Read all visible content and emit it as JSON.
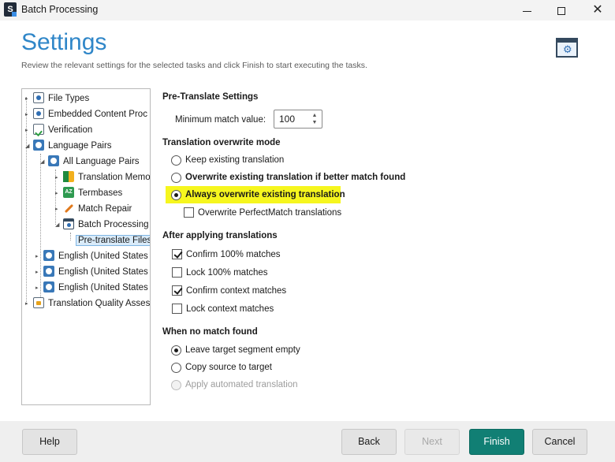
{
  "window": {
    "title": "Batch Processing",
    "app_icon_letter": "S",
    "minimize_icon": "minimize-icon",
    "maximize_icon": "maximize-icon",
    "close_icon": "close-icon",
    "close_glyph": "✕"
  },
  "header": {
    "title": "Settings",
    "subtitle": "Review the relevant settings for the selected tasks and click Finish to start executing the tasks."
  },
  "tree": {
    "items": [
      {
        "label": "File Types",
        "icon": "file-types-icon"
      },
      {
        "label": "Embedded Content Proc",
        "icon": "embedded-content-icon"
      },
      {
        "label": "Verification",
        "icon": "verification-icon"
      },
      {
        "label": "Language Pairs",
        "icon": "language-pairs-icon"
      },
      {
        "label": "All Language Pairs",
        "icon": "language-pair-icon"
      },
      {
        "label": "Translation Memo",
        "icon": "translation-memory-icon"
      },
      {
        "label": "Termbases",
        "icon": "termbase-icon"
      },
      {
        "label": "Match Repair",
        "icon": "wrench-icon"
      },
      {
        "label": "Batch Processing",
        "icon": "batch-processing-icon"
      },
      {
        "label": "Pre-translate Files",
        "icon": ""
      },
      {
        "label": "English (United States",
        "icon": "language-pair-icon"
      },
      {
        "label": "English (United States",
        "icon": "language-pair-icon"
      },
      {
        "label": "English (United States",
        "icon": "language-pair-icon"
      },
      {
        "label": "Translation Quality Assess",
        "icon": "quality-assessment-icon"
      }
    ],
    "selected": "Pre-translate Files"
  },
  "settings": {
    "pretranslate_heading": "Pre-Translate Settings",
    "min_match_label": "Minimum match value:",
    "min_match_value": "100",
    "overwrite_heading": "Translation overwrite mode",
    "overwrite_options": [
      {
        "label": "Keep existing translation",
        "selected": false
      },
      {
        "label": "Overwrite existing translation if better match found",
        "selected": false
      },
      {
        "label": "Always overwrite existing translation",
        "selected": true
      }
    ],
    "overwrite_perfectmatch_label": "Overwrite PerfectMatch translations",
    "overwrite_perfectmatch_checked": false,
    "after_heading": "After applying translations",
    "after_options": [
      {
        "label": "Confirm 100% matches",
        "checked": true
      },
      {
        "label": "Lock 100% matches",
        "checked": false
      },
      {
        "label": "Confirm context matches",
        "checked": true
      },
      {
        "label": "Lock context matches",
        "checked": false
      }
    ],
    "nomatch_heading": "When no match found",
    "nomatch_options": [
      {
        "label": "Leave target segment empty",
        "selected": true,
        "enabled": true
      },
      {
        "label": "Copy source to target",
        "selected": false,
        "enabled": true
      },
      {
        "label": "Apply automated translation",
        "selected": false,
        "enabled": false
      }
    ],
    "highlight_color": "#f6f61e"
  },
  "footer": {
    "help_label": "Help",
    "back_label": "Back",
    "next_label": "Next",
    "finish_label": "Finish",
    "cancel_label": "Cancel",
    "finish_color": "#117f74"
  }
}
